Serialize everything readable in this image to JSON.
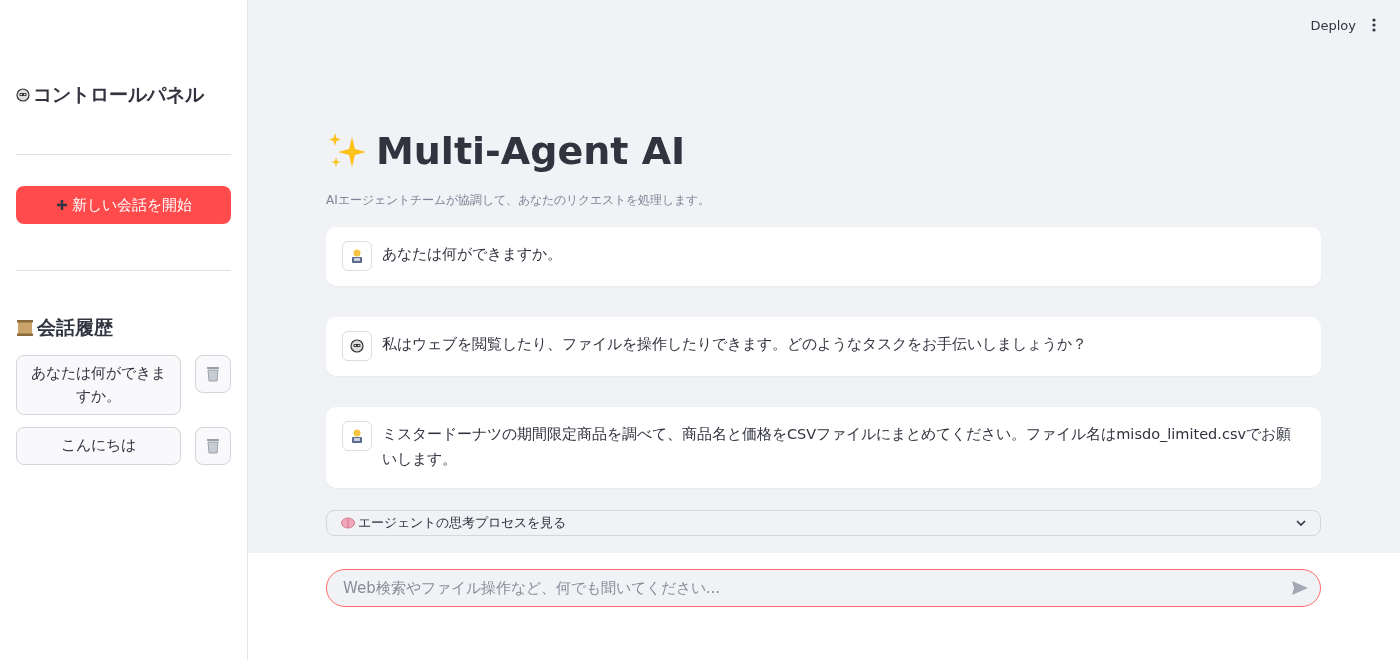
{
  "sidebar": {
    "title": "コントロールパネル",
    "new_chat_button": "新しい会話を開始",
    "history_title": "会話履歴",
    "history": [
      {
        "label": "あなたは何ができますか。"
      },
      {
        "label": "こんにちは"
      }
    ]
  },
  "header": {
    "deploy": "Deploy"
  },
  "main": {
    "title": "Multi-Agent AI",
    "subtitle": "AIエージェントチームが協調して、あなたのリクエストを処理します。",
    "messages": [
      {
        "kind": "user",
        "text": "あなたは何ができますか。"
      },
      {
        "kind": "assistant",
        "text": "私はウェブを閲覧したり、ファイルを操作したりできます。どのようなタスクをお手伝いしましょうか？"
      },
      {
        "kind": "user",
        "text": "ミスタードーナツの期間限定商品を調べて、商品名と価格をCSVファイルにまとめてください。ファイル名はmisdo_limited.csvでお願いします。"
      }
    ],
    "expander": {
      "label": "エージェントの思考プロセスを見る",
      "expanded": false
    }
  },
  "chat_input": {
    "placeholder": "Web検索やファイル操作など、何でも聞いてください..."
  }
}
